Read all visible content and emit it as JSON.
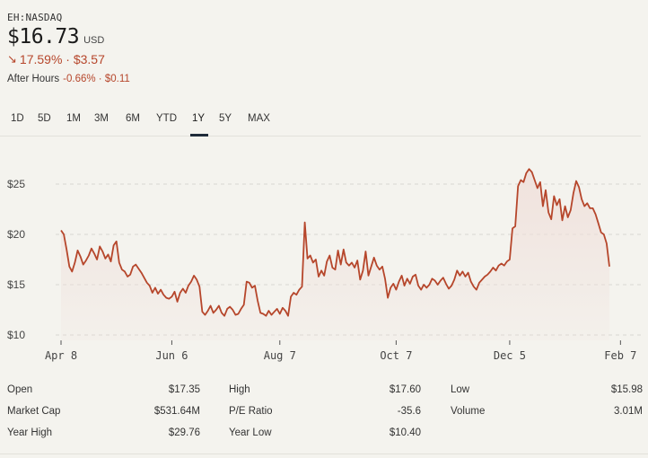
{
  "header": {
    "ticker": "EH:NASDAQ",
    "price": "$16.73",
    "currency": "USD",
    "change_arrow": "↘",
    "change": "17.59% · $3.57",
    "after_hours_label": "After Hours",
    "after_hours_change": "-0.66% · $0.11"
  },
  "tabs": [
    "1D",
    "5D",
    "1M",
    "3M",
    "6M",
    "YTD",
    "1Y",
    "5Y",
    "MAX"
  ],
  "active_tab": "1Y",
  "colors": {
    "line": "#b6462b",
    "fill": "#f0e1dc",
    "grid": "#d8d7d1",
    "background": "#f4f3ee"
  },
  "chart_data": {
    "type": "area",
    "y_ticks": [
      "$25",
      "$20",
      "$15",
      "$10"
    ],
    "y_tick_values": [
      25,
      20,
      15,
      10
    ],
    "ylim": [
      9.5,
      28
    ],
    "x_ticks": [
      "Apr 8",
      "Jun 6",
      "Aug 7",
      "Oct 7",
      "Dec 5",
      "Feb 7"
    ],
    "x_tick_index": [
      0,
      40,
      79,
      121,
      162,
      202
    ],
    "values": [
      20.4,
      20.0,
      18.5,
      16.8,
      16.3,
      17.2,
      18.4,
      17.8,
      17.0,
      17.4,
      17.9,
      18.6,
      18.1,
      17.5,
      18.8,
      18.3,
      17.6,
      18.0,
      17.3,
      18.9,
      19.3,
      17.2,
      16.5,
      16.3,
      15.8,
      16.0,
      16.8,
      17.0,
      16.6,
      16.2,
      15.7,
      15.2,
      14.9,
      14.2,
      14.7,
      14.1,
      14.5,
      14.0,
      13.7,
      13.6,
      13.8,
      14.3,
      13.3,
      14.2,
      14.6,
      14.2,
      14.9,
      15.3,
      15.9,
      15.5,
      14.8,
      12.3,
      12.0,
      12.4,
      12.9,
      12.2,
      12.5,
      12.9,
      12.2,
      11.9,
      12.6,
      12.8,
      12.5,
      12.0,
      12.1,
      12.6,
      13.0,
      15.3,
      15.2,
      14.7,
      14.9,
      13.4,
      12.2,
      12.1,
      11.9,
      12.4,
      12.0,
      12.3,
      12.6,
      12.1,
      12.7,
      12.4,
      11.9,
      13.8,
      14.2,
      14.0,
      14.5,
      14.8,
      21.2,
      17.6,
      17.9,
      17.2,
      17.5,
      15.8,
      16.4,
      15.9,
      17.3,
      17.9,
      16.7,
      16.5,
      18.4,
      17.0,
      18.5,
      17.2,
      16.9,
      17.2,
      16.7,
      17.4,
      15.5,
      16.4,
      18.3,
      15.9,
      16.8,
      17.7,
      16.9,
      16.5,
      16.8,
      15.6,
      13.7,
      14.7,
      15.1,
      14.5,
      15.3,
      15.9,
      14.9,
      15.6,
      15.1,
      15.8,
      16.0,
      14.9,
      14.5,
      15.0,
      14.7,
      15.0,
      15.6,
      15.4,
      15.0,
      15.4,
      15.7,
      15.1,
      14.6,
      14.9,
      15.5,
      16.4,
      15.9,
      16.3,
      15.8,
      16.2,
      15.3,
      14.8,
      14.5,
      15.2,
      15.5,
      15.8,
      16.0,
      16.3,
      16.7,
      16.4,
      16.9,
      17.1,
      16.9,
      17.3,
      17.5,
      20.6,
      20.8,
      24.8,
      25.4,
      25.2,
      26.1,
      26.5,
      26.2,
      25.4,
      24.6,
      25.2,
      22.8,
      24.4,
      22.2,
      21.5,
      23.8,
      22.9,
      23.5,
      21.4,
      22.8,
      21.7,
      22.4,
      24.1,
      25.3,
      24.7,
      23.5,
      22.8,
      23.1,
      22.6,
      22.6,
      22.0,
      21.1,
      20.2,
      20.0,
      19.1,
      16.8
    ]
  },
  "stats": {
    "open_label": "Open",
    "open": "$17.35",
    "high_label": "High",
    "high": "$17.60",
    "low_label": "Low",
    "low": "$15.98",
    "mcap_label": "Market Cap",
    "mcap": "$531.64M",
    "pe_label": "P/E Ratio",
    "pe": "-35.6",
    "volume_label": "Volume",
    "volume": "3.01M",
    "yhigh_label": "Year High",
    "yhigh": "$29.76",
    "ylow_label": "Year Low",
    "ylow": "$10.40"
  }
}
